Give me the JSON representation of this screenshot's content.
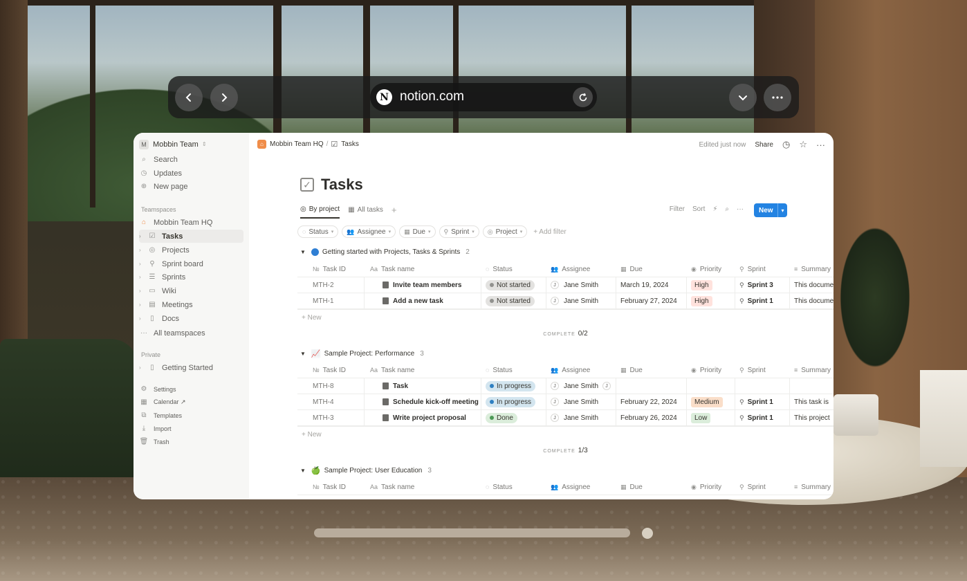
{
  "browser": {
    "url": "notion.com",
    "back_icon": "chevron-left-icon",
    "forward_icon": "chevron-right-icon",
    "reload_icon": "reload-icon",
    "menu_icon": "chevron-down-icon",
    "more_icon": "ellipsis-icon"
  },
  "sidebar": {
    "workspace_badge": "M",
    "workspace": "Mobbin Team",
    "top_items": [
      {
        "label": "Search",
        "icon": "search-icon"
      },
      {
        "label": "Updates",
        "icon": "clock-icon"
      },
      {
        "label": "New page",
        "icon": "plus-circle-icon"
      }
    ],
    "teamspaces_heading": "Teamspaces",
    "teamspace_items": [
      {
        "label": "Mobbin Team HQ",
        "icon": "home-icon"
      },
      {
        "label": "Tasks",
        "icon": "checkbox-icon",
        "active": true
      },
      {
        "label": "Projects",
        "icon": "target-icon"
      },
      {
        "label": "Sprint board",
        "icon": "runner-icon"
      },
      {
        "label": "Sprints",
        "icon": "database-icon"
      },
      {
        "label": "Wiki",
        "icon": "book-icon"
      },
      {
        "label": "Meetings",
        "icon": "table-icon"
      },
      {
        "label": "Docs",
        "icon": "doc-icon"
      },
      {
        "label": "All teamspaces",
        "icon": "ellipsis-icon"
      }
    ],
    "private_heading": "Private",
    "private_items": [
      {
        "label": "Getting Started",
        "icon": "doc-icon"
      }
    ],
    "bottom_items": [
      {
        "label": "Settings",
        "icon": "gear-icon"
      },
      {
        "label": "Calendar ↗",
        "icon": "calendar-icon"
      },
      {
        "label": "Templates",
        "icon": "templates-icon"
      },
      {
        "label": "Import",
        "icon": "download-icon"
      },
      {
        "label": "Trash",
        "icon": "trash-icon"
      }
    ]
  },
  "topbar": {
    "breadcrumb_parent": "Mobbin Team HQ",
    "breadcrumb_sep": "/",
    "breadcrumb_current": "Tasks",
    "edited": "Edited just now",
    "share": "Share"
  },
  "page": {
    "title": "Tasks",
    "views": [
      "By project",
      "All tasks"
    ],
    "tools": [
      "Filter",
      "Sort"
    ],
    "new_button": "New",
    "filters": [
      "Status",
      "Assignee",
      "Due",
      "Sprint",
      "Project"
    ],
    "add_filter": "+ Add filter"
  },
  "columns": [
    "Task ID",
    "Task name",
    "Status",
    "Assignee",
    "Due",
    "Priority",
    "Sprint",
    "Summary"
  ],
  "groups": [
    {
      "title": "Getting started with Projects, Tasks & Sprints",
      "count": "2",
      "rows": [
        {
          "id": "MTH-2",
          "name": "Invite team members",
          "status": "Not started",
          "assignee": "Jane Smith",
          "due": "March 19, 2024",
          "priority": "High",
          "sprint": "Sprint 3",
          "summary": "This docume"
        },
        {
          "id": "MTH-1",
          "name": "Add a new task",
          "status": "Not started",
          "assignee": "Jane Smith",
          "due": "February 27, 2024",
          "priority": "High",
          "sprint": "Sprint 1",
          "summary": "This docume"
        }
      ],
      "new": "+ New",
      "complete_label": "COMPLETE",
      "complete_value": "0/2"
    },
    {
      "title": "Sample Project: Performance",
      "count": "3",
      "rows": [
        {
          "id": "MTH-8",
          "name": "Task",
          "status": "In progress",
          "assignee": "Jane Smith",
          "assignee_extra": "J",
          "due": "",
          "priority": "",
          "sprint": "",
          "summary": ""
        },
        {
          "id": "MTH-4",
          "name": "Schedule kick-off meeting",
          "status": "In progress",
          "assignee": "Jane Smith",
          "due": "February 22, 2024",
          "priority": "Medium",
          "sprint": "Sprint 1",
          "summary": "This task is"
        },
        {
          "id": "MTH-3",
          "name": "Write project proposal",
          "status": "Done",
          "assignee": "Jane Smith",
          "due": "February 26, 2024",
          "priority": "Low",
          "sprint": "Sprint 1",
          "summary": "This project"
        }
      ],
      "new": "+ New",
      "complete_label": "COMPLETE",
      "complete_value": "1/3"
    },
    {
      "title": "Sample Project: User Education",
      "count": "3"
    }
  ],
  "colors": {
    "accent": "#2383e2",
    "not_started_bg": "#e3e2e0",
    "in_progress_bg": "#d3e5ef",
    "done_bg": "#dbeddb",
    "high_bg": "#ffe2dd",
    "medium_bg": "#fadec9",
    "low_bg": "#dbeddb"
  }
}
